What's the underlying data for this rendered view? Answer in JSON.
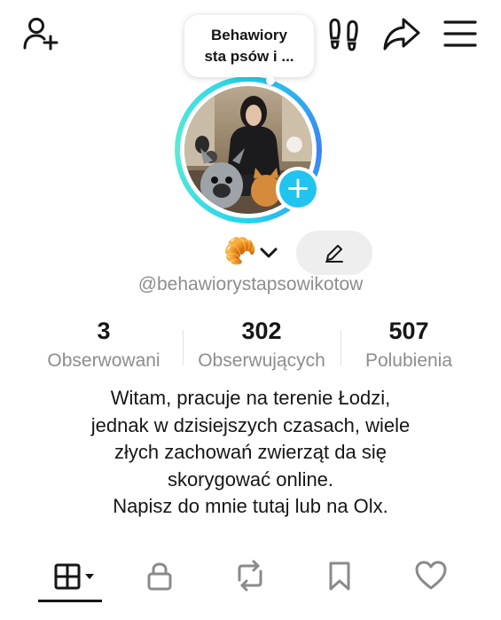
{
  "header": {
    "add_user_icon": "person-plus-icon",
    "footprints_icon": "footprints-icon",
    "share_icon": "share-arrow-icon",
    "menu_icon": "hamburger-menu-icon"
  },
  "note_bubble": {
    "line1": "Behawiory",
    "line2": "sta psów i ..."
  },
  "profile": {
    "emoji": "🥐",
    "username": "@behawiorystapsowikotow",
    "ring_color": "#22d3ee",
    "add_badge_color": "#20c4ee"
  },
  "stats": [
    {
      "value": "3",
      "label": "Obserwowani"
    },
    {
      "value": "302",
      "label": "Obserwujących"
    },
    {
      "value": "507",
      "label": "Polubienia"
    }
  ],
  "bio": {
    "line1": "Witam, pracuje na terenie Łodzi,",
    "line2": "jednak w dzisiejszych czasach, wiele",
    "line3": "złych zachowań zwierząt da się",
    "line4": "skorygować online.",
    "line5": "Napisz do mnie tutaj lub na Olx."
  },
  "tabs": [
    {
      "icon": "grid-icon",
      "active": true
    },
    {
      "icon": "lock-icon",
      "active": false
    },
    {
      "icon": "repost-icon",
      "active": false
    },
    {
      "icon": "bookmark-icon",
      "active": false
    },
    {
      "icon": "heart-icon",
      "active": false
    }
  ]
}
